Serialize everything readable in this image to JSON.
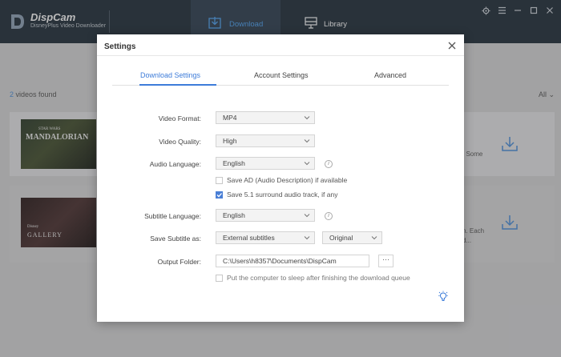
{
  "app": {
    "name": "DispCam",
    "subtitle": "DisneyPlus Video Downloader"
  },
  "nav": {
    "download": "Download",
    "library": "Library"
  },
  "list": {
    "count_number": "2",
    "count_text": " videos found",
    "filter": "All",
    "rows": [
      {
        "thumb_title": "MANDALORIAN",
        "thumb_top": "STAR WARS",
        "side_text": ". Some"
      },
      {
        "thumb_title": "GALLERY",
        "thumb_top": "Disney",
        "side_text_1": "n. Each",
        "side_text_2": "d..."
      }
    ]
  },
  "settings": {
    "title": "Settings",
    "tabs": [
      "Download Settings",
      "Account Settings",
      "Advanced"
    ],
    "active_tab": "Download Settings",
    "video_format": {
      "label": "Video Format:",
      "value": "MP4"
    },
    "video_quality": {
      "label": "Video Quality:",
      "value": "High"
    },
    "audio_language": {
      "label": "Audio Language:",
      "value": "English"
    },
    "save_ad": {
      "label": "Save AD (Audio Description) if available",
      "checked": false
    },
    "save_51": {
      "label": "Save 5.1 surround audio track, if any",
      "checked": true
    },
    "subtitle_language": {
      "label": "Subtitle Language:",
      "value": "English"
    },
    "save_subtitle": {
      "label": "Save Subtitle as:",
      "value": "External subtitles",
      "value2": "Original"
    },
    "output_folder": {
      "label": "Output Folder:",
      "value": "C:\\Users\\h8357\\Documents\\DispCam",
      "browse": "···"
    },
    "sleep": {
      "label": "Put the computer to sleep after finishing the download queue",
      "checked": false
    }
  },
  "colors": {
    "accent": "#3d7cd9",
    "header": "#1f2d3a",
    "nav_active": "#2d3e50"
  }
}
